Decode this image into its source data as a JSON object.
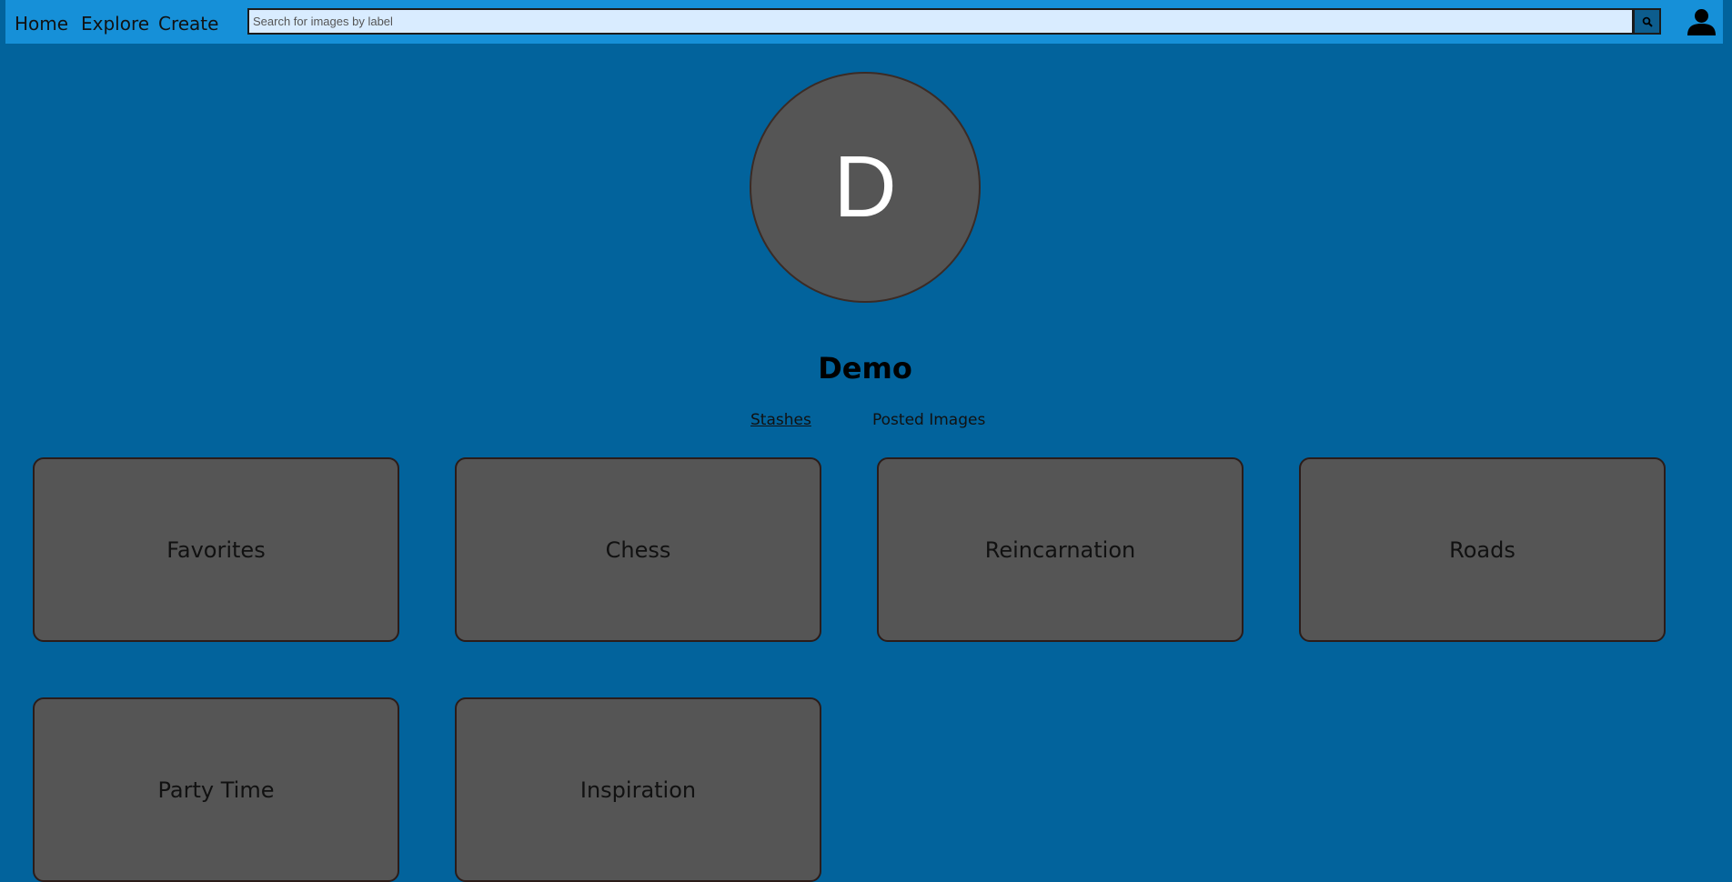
{
  "nav": {
    "home": "Home",
    "explore": "Explore",
    "create": "Create"
  },
  "search": {
    "placeholder": "Search for images by label",
    "value": "",
    "button_icon": "search-icon"
  },
  "profile": {
    "menu_icon": "user-icon",
    "avatar_initial": "D",
    "username": "Demo"
  },
  "tabs": [
    {
      "label": "Stashes",
      "active": true
    },
    {
      "label": "Posted Images",
      "active": false
    }
  ],
  "stashes": [
    {
      "label": "Favorites"
    },
    {
      "label": "Chess"
    },
    {
      "label": "Reincarnation"
    },
    {
      "label": "Roads"
    },
    {
      "label": "Party Time"
    },
    {
      "label": "Inspiration"
    }
  ],
  "colors": {
    "background": "#02639c",
    "navbar": "#1690d8",
    "card": "#555555",
    "search_field": "#d9ecff"
  }
}
